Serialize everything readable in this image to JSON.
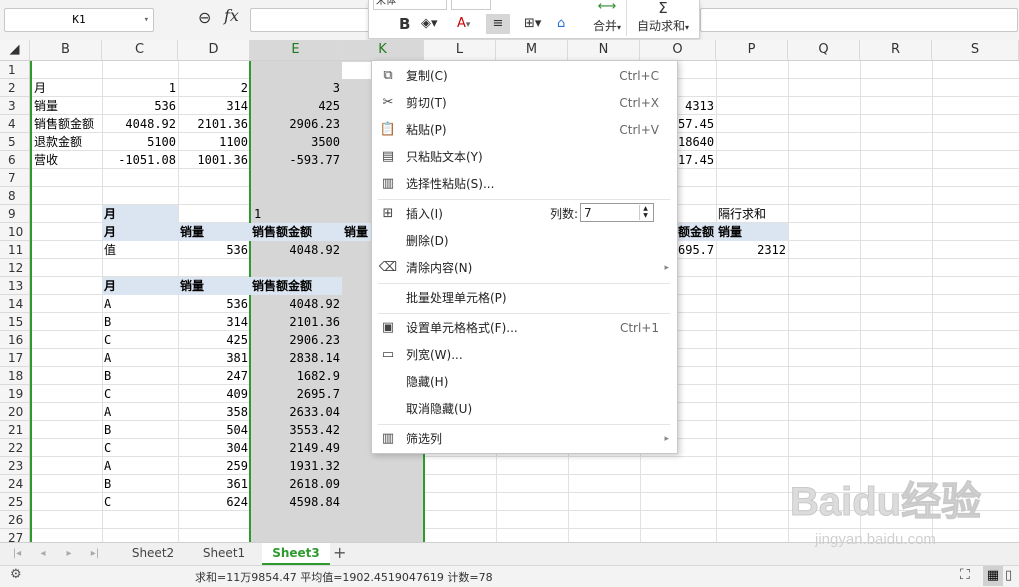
{
  "formula_bar": {
    "name_box": "K1",
    "fx": "fx"
  },
  "mini_toolbar": {
    "font_name": "宋体",
    "bold": "B",
    "font_color": "A",
    "merge_label": "合并",
    "autosum_label": "自动求和"
  },
  "columns": [
    "B",
    "C",
    "D",
    "E",
    "K",
    "L",
    "M",
    "N",
    "O",
    "P",
    "Q",
    "R",
    "S"
  ],
  "rows": [
    "1",
    "2",
    "3",
    "4",
    "5",
    "6",
    "7",
    "8",
    "9",
    "10",
    "11",
    "12",
    "13",
    "14",
    "15",
    "16",
    "17",
    "18",
    "19",
    "20",
    "21",
    "22",
    "23",
    "24",
    "25",
    "26",
    "27"
  ],
  "cells": {
    "r2": [
      "月",
      "1",
      "2",
      "3"
    ],
    "r3": [
      "销量",
      "536",
      "314",
      "425"
    ],
    "r4": [
      "销售额金额",
      "4048.92",
      "2101.36",
      "2906.23"
    ],
    "r5": [
      "退款金额",
      "5100",
      "1100",
      "3500"
    ],
    "r6": [
      "营收",
      "-1051.08",
      "1001.36",
      "-593.77"
    ],
    "o3": "4313",
    "o4": "57.45",
    "o5": "18640",
    "o6": "17.45",
    "r9": [
      "月",
      "1"
    ],
    "r9_p": "隔行求和",
    "r10": [
      "月",
      "销量",
      "销售额金额",
      "销量"
    ],
    "r10_o": "额金额",
    "r10_p": "销量",
    "r11": [
      "值",
      "536",
      "4048.92"
    ],
    "r11_o": "695.7",
    "r11_p": "2312",
    "r13": [
      "月",
      "销量",
      "销售额金额"
    ],
    "table": [
      [
        "A",
        "536",
        "4048.92"
      ],
      [
        "B",
        "314",
        "2101.36"
      ],
      [
        "C",
        "425",
        "2906.23"
      ],
      [
        "A",
        "381",
        "2838.14"
      ],
      [
        "B",
        "247",
        "1682.9"
      ],
      [
        "C",
        "409",
        "2695.7"
      ],
      [
        "A",
        "358",
        "2633.04"
      ],
      [
        "B",
        "504",
        "3553.42"
      ],
      [
        "C",
        "304",
        "2149.49"
      ],
      [
        "A",
        "259",
        "1931.32"
      ],
      [
        "B",
        "361",
        "2618.09"
      ],
      [
        "C",
        "624",
        "4598.84"
      ]
    ]
  },
  "context_menu": {
    "copy": {
      "label": "复制(C)",
      "shortcut": "Ctrl+C"
    },
    "cut": {
      "label": "剪切(T)",
      "shortcut": "Ctrl+X"
    },
    "paste": {
      "label": "粘贴(P)",
      "shortcut": "Ctrl+V"
    },
    "paste_text": {
      "label": "只粘贴文本(Y)"
    },
    "paste_special": {
      "label": "选择性粘贴(S)..."
    },
    "insert": {
      "label": "插入(I)",
      "cols_label": "列数:",
      "cols_value": "7"
    },
    "delete": {
      "label": "删除(D)"
    },
    "clear": {
      "label": "清除内容(N)"
    },
    "batch": {
      "label": "批量处理单元格(P)"
    },
    "format": {
      "label": "设置单元格格式(F)...",
      "shortcut": "Ctrl+1"
    },
    "col_width": {
      "label": "列宽(W)..."
    },
    "hide": {
      "label": "隐藏(H)"
    },
    "unhide": {
      "label": "取消隐藏(U)"
    },
    "filter": {
      "label": "筛选列"
    }
  },
  "sheet_tabs": [
    "Sheet2",
    "Sheet1",
    "Sheet3"
  ],
  "active_sheet": "Sheet3",
  "status": {
    "text": "求和=11万9854.47  平均值=1902.4519047619  计数=78"
  },
  "watermark": {
    "logo": "Baidu经验",
    "url": "jingyan.baidu.com"
  }
}
